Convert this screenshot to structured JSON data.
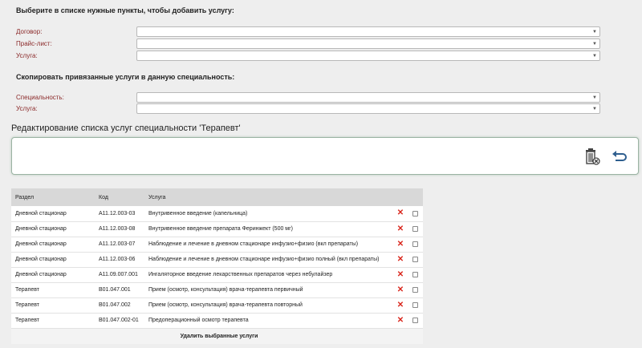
{
  "add_section": {
    "title": "Выберите в списке нужные пункты, чтобы добавить услугу:",
    "fields": [
      {
        "label": "Договор:",
        "value": ""
      },
      {
        "label": "Прайс-лист:",
        "value": ""
      },
      {
        "label": "Услуга:",
        "value": ""
      }
    ]
  },
  "copy_section": {
    "title": "Скопировать привязанные услуги в данную специальность:",
    "fields": [
      {
        "label": "Специальность:",
        "value": ""
      },
      {
        "label": "Услуга:",
        "value": ""
      }
    ]
  },
  "edit_title": "Редактирование списка услуг специальности 'Терапевт'",
  "toolbar": {
    "delete_icon": "trash-delete-icon",
    "back_icon": "return-arrow-icon"
  },
  "table": {
    "headers": [
      "Раздел",
      "Код",
      "Услуга"
    ],
    "rows": [
      {
        "section": "Дневной стационар",
        "code": "A11.12.003-03",
        "service": "Внутривенное введение (капельница)"
      },
      {
        "section": "Дневной стационар",
        "code": "A11.12.003-08",
        "service": "Внутривенное введение препарата Феринжект (500 мг)"
      },
      {
        "section": "Дневной стационар",
        "code": "A11.12.003-07",
        "service": "Наблюдение и лечение в дневном стационаре инфузио+физио (вкл препараты)"
      },
      {
        "section": "Дневной стационар",
        "code": "A11.12.003-06",
        "service": "Наблюдение и лечение в дневном стационаре инфузио+физио полный (вкл препараты)"
      },
      {
        "section": "Дневной стационар",
        "code": "A11.09.007.001",
        "service": "Ингаляторное введение лекарственных препаратов через небулайзер"
      },
      {
        "section": "Терапевт",
        "code": "B01.047.001",
        "service": "Прием (осмотр, консультация) врача-терапевта первичный"
      },
      {
        "section": "Терапевт",
        "code": "B01.047.002",
        "service": "Прием (осмотр, консультация) врача-терапевта повторный"
      },
      {
        "section": "Терапевт",
        "code": "B01.047.002-01",
        "service": "Предоперационный осмотр терапевта"
      }
    ],
    "delete_selected_label": "Удалить выбранные услуги"
  },
  "colors": {
    "field_label": "#8b2a2a",
    "delete_mark": "#d9261c",
    "panel_border": "#9bb3a3"
  }
}
